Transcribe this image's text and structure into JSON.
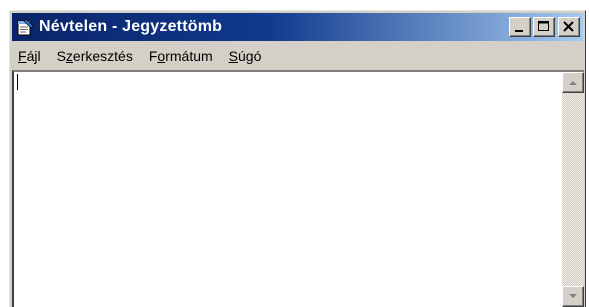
{
  "window": {
    "title": "Névtelen - Jegyzettömb",
    "icon": "notepad-icon",
    "buttons": [
      "minimize-icon",
      "maximize-icon",
      "close-icon"
    ]
  },
  "menu": {
    "file": {
      "accel": "F",
      "rest": "ájl"
    },
    "edit": {
      "pre": "S",
      "accel": "z",
      "rest": "erkesztés"
    },
    "format": {
      "pre": "F",
      "accel": "o",
      "rest": "rmátum"
    },
    "help": {
      "accel": "S",
      "rest": "úgó"
    }
  },
  "editor": {
    "content": ""
  },
  "colors": {
    "titlebar_start": "#0a246a",
    "titlebar_end": "#a6caf0",
    "chrome": "#d4d0c8"
  }
}
